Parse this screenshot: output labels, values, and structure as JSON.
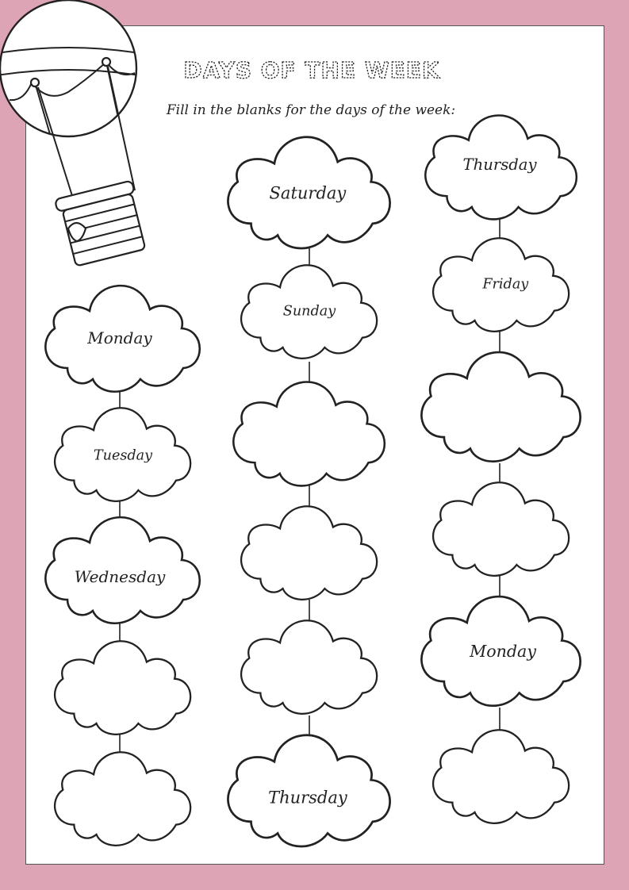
{
  "worksheet": {
    "title": "DAYS OF THE WEEK",
    "instruction": "Fill in the blanks for the days of the week:"
  },
  "columns": [
    [
      "Monday",
      "Tuesday",
      "Wednesday",
      "",
      ""
    ],
    [
      "Saturday",
      "Sunday",
      "",
      "",
      "",
      "Thursday"
    ],
    [
      "Thursday",
      "Friday",
      "",
      "",
      "Monday",
      ""
    ]
  ]
}
